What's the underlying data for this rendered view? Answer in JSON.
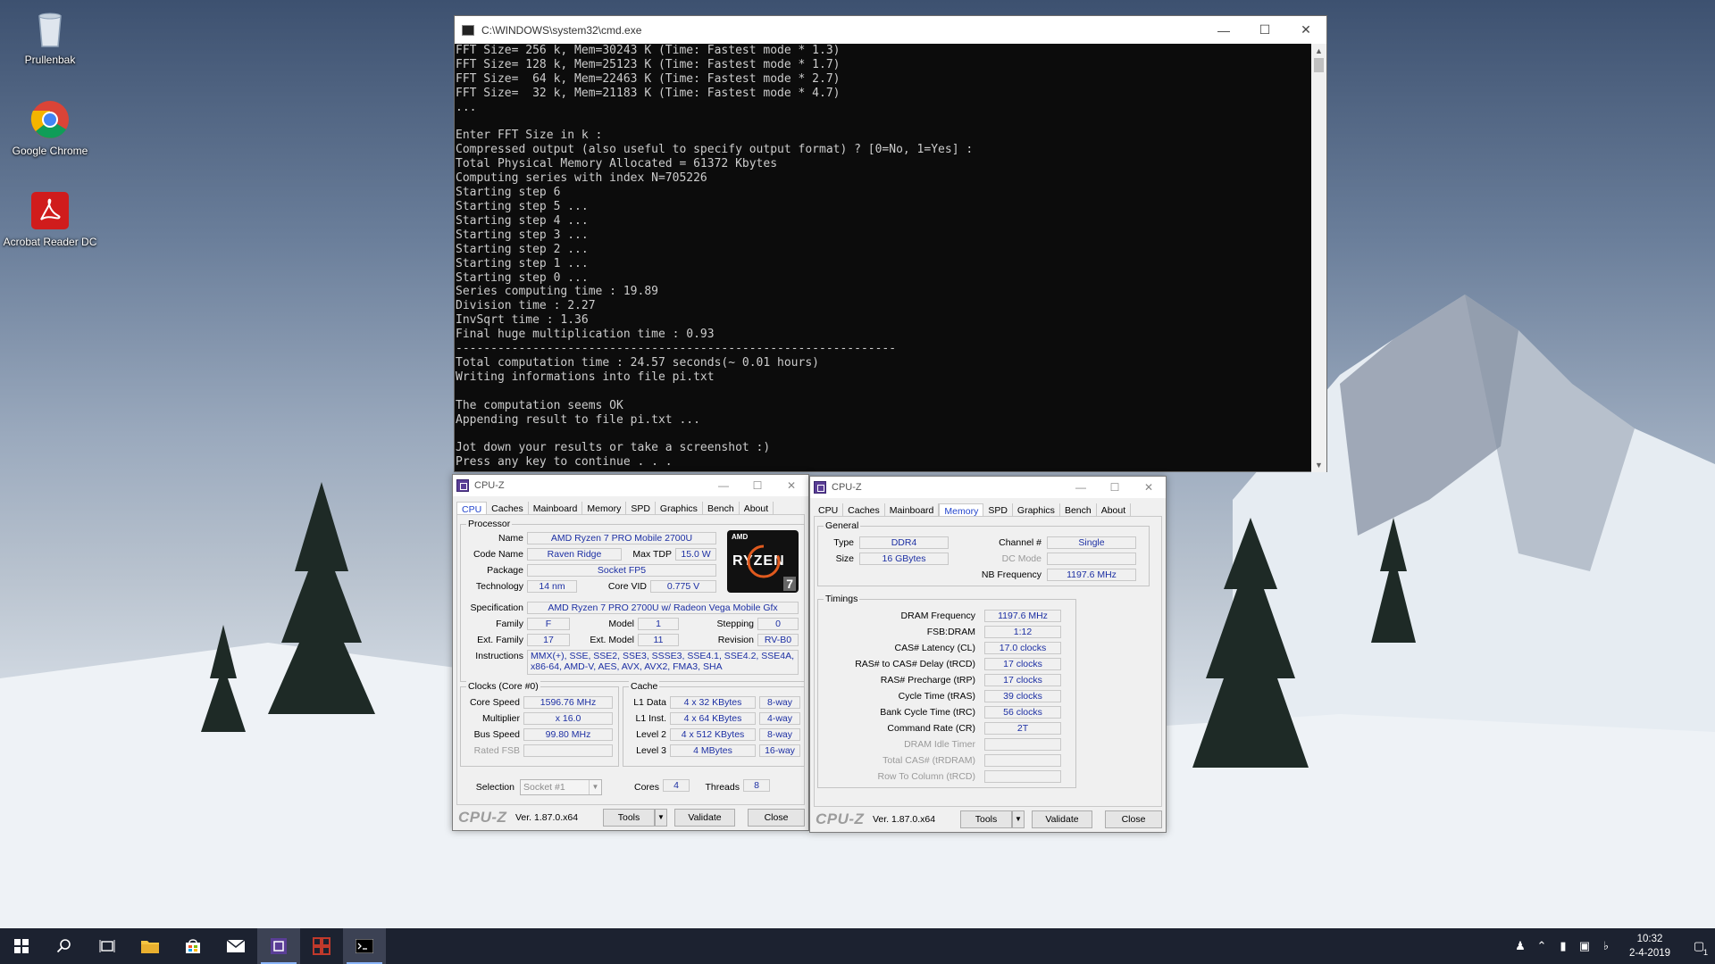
{
  "desktop": {
    "icons": [
      {
        "label": "Prullenbak"
      },
      {
        "label": "Google Chrome"
      },
      {
        "label": "Acrobat Reader DC"
      }
    ]
  },
  "cmd": {
    "title": "C:\\WINDOWS\\system32\\cmd.exe",
    "output": "FFT Size= 256 k, Mem=30243 K (Time: Fastest mode * 1.3)\nFFT Size= 128 k, Mem=25123 K (Time: Fastest mode * 1.7)\nFFT Size=  64 k, Mem=22463 K (Time: Fastest mode * 2.7)\nFFT Size=  32 k, Mem=21183 K (Time: Fastest mode * 4.7)\n...\n\nEnter FFT Size in k :\nCompressed output (also useful to specify output format) ? [0=No, 1=Yes] :\nTotal Physical Memory Allocated = 61372 Kbytes\nComputing series with index N=705226\nStarting step 6\nStarting step 5 ...\nStarting step 4 ...\nStarting step 3 ...\nStarting step 2 ...\nStarting step 1 ...\nStarting step 0 ...\nSeries computing time : 19.89\nDivision time : 2.27\nInvSqrt time : 1.36\nFinal huge multiplication time : 0.93\n---------------------------------------------------------------\nTotal computation time : 24.57 seconds(~ 0.01 hours)\nWriting informations into file pi.txt\n\nThe computation seems OK\nAppending result to file pi.txt ...\n\nJot down your results or take a screenshot :)\nPress any key to continue . . ."
  },
  "cpuz_cpu": {
    "title": "CPU-Z",
    "tabs": [
      "CPU",
      "Caches",
      "Mainboard",
      "Memory",
      "SPD",
      "Graphics",
      "Bench",
      "About"
    ],
    "active_tab": "CPU",
    "processor": {
      "section": "Processor",
      "name_label": "Name",
      "name": "AMD Ryzen 7 PRO Mobile 2700U",
      "codename_label": "Code Name",
      "codename": "Raven Ridge",
      "maxtdp_label": "Max TDP",
      "maxtdp": "15.0 W",
      "package_label": "Package",
      "package": "Socket FP5",
      "technology_label": "Technology",
      "technology": "14 nm",
      "corevid_label": "Core VID",
      "corevid": "0.775 V",
      "spec_label": "Specification",
      "spec": "AMD Ryzen 7 PRO 2700U w/ Radeon Vega Mobile Gfx",
      "family_label": "Family",
      "family": "F",
      "model_label": "Model",
      "model": "1",
      "stepping_label": "Stepping",
      "stepping": "0",
      "extfamily_label": "Ext. Family",
      "extfamily": "17",
      "extmodel_label": "Ext. Model",
      "extmodel": "11",
      "revision_label": "Revision",
      "revision": "RV-B0",
      "instructions_label": "Instructions",
      "instructions": "MMX(+), SSE, SSE2, SSE3, SSSE3, SSE4.1, SSE4.2, SSE4A, x86-64, AMD-V, AES, AVX, AVX2, FMA3, SHA"
    },
    "logo": {
      "amd": "AMD",
      "ryzen": "RYZEN",
      "tier": "7"
    },
    "clocks": {
      "section": "Clocks (Core #0)",
      "corespeed_label": "Core Speed",
      "corespeed": "1596.76 MHz",
      "multiplier_label": "Multiplier",
      "multiplier": "x 16.0",
      "busspeed_label": "Bus Speed",
      "busspeed": "99.80 MHz",
      "ratedfsb_label": "Rated FSB",
      "ratedfsb": ""
    },
    "cache": {
      "section": "Cache",
      "l1data_label": "L1 Data",
      "l1data": "4 x 32 KBytes",
      "l1data_way": "8-way",
      "l1inst_label": "L1 Inst.",
      "l1inst": "4 x 64 KBytes",
      "l1inst_way": "4-way",
      "l2_label": "Level 2",
      "l2": "4 x 512 KBytes",
      "l2_way": "8-way",
      "l3_label": "Level 3",
      "l3": "4 MBytes",
      "l3_way": "16-way"
    },
    "selection_label": "Selection",
    "selection": "Socket #1",
    "cores_label": "Cores",
    "cores": "4",
    "threads_label": "Threads",
    "threads": "8",
    "footer": {
      "brand": "CPU-Z",
      "version": "Ver. 1.87.0.x64",
      "tools": "Tools",
      "validate": "Validate",
      "close": "Close"
    }
  },
  "cpuz_mem": {
    "title": "CPU-Z",
    "tabs": [
      "CPU",
      "Caches",
      "Mainboard",
      "Memory",
      "SPD",
      "Graphics",
      "Bench",
      "About"
    ],
    "active_tab": "Memory",
    "general": {
      "section": "General",
      "type_label": "Type",
      "type": "DDR4",
      "size_label": "Size",
      "size": "16 GBytes",
      "channel_label": "Channel #",
      "channel": "Single",
      "dcmode_label": "DC Mode",
      "dcmode": "",
      "nbfreq_label": "NB Frequency",
      "nbfreq": "1197.6 MHz"
    },
    "timings": {
      "section": "Timings",
      "rows": [
        {
          "label": "DRAM Frequency",
          "value": "1197.6 MHz",
          "dim": false
        },
        {
          "label": "FSB:DRAM",
          "value": "1:12",
          "dim": false
        },
        {
          "label": "CAS# Latency (CL)",
          "value": "17.0 clocks",
          "dim": false
        },
        {
          "label": "RAS# to CAS# Delay (tRCD)",
          "value": "17 clocks",
          "dim": false
        },
        {
          "label": "RAS# Precharge (tRP)",
          "value": "17 clocks",
          "dim": false
        },
        {
          "label": "Cycle Time (tRAS)",
          "value": "39 clocks",
          "dim": false
        },
        {
          "label": "Bank Cycle Time (tRC)",
          "value": "56 clocks",
          "dim": false
        },
        {
          "label": "Command Rate (CR)",
          "value": "2T",
          "dim": false
        },
        {
          "label": "DRAM Idle Timer",
          "value": "",
          "dim": true
        },
        {
          "label": "Total CAS# (tRDRAM)",
          "value": "",
          "dim": true
        },
        {
          "label": "Row To Column (tRCD)",
          "value": "",
          "dim": true
        }
      ]
    },
    "footer": {
      "brand": "CPU-Z",
      "version": "Ver. 1.87.0.x64",
      "tools": "Tools",
      "validate": "Validate",
      "close": "Close"
    }
  },
  "taskbar": {
    "time": "10:32",
    "date": "2-4-2019",
    "notification_count": "1"
  }
}
